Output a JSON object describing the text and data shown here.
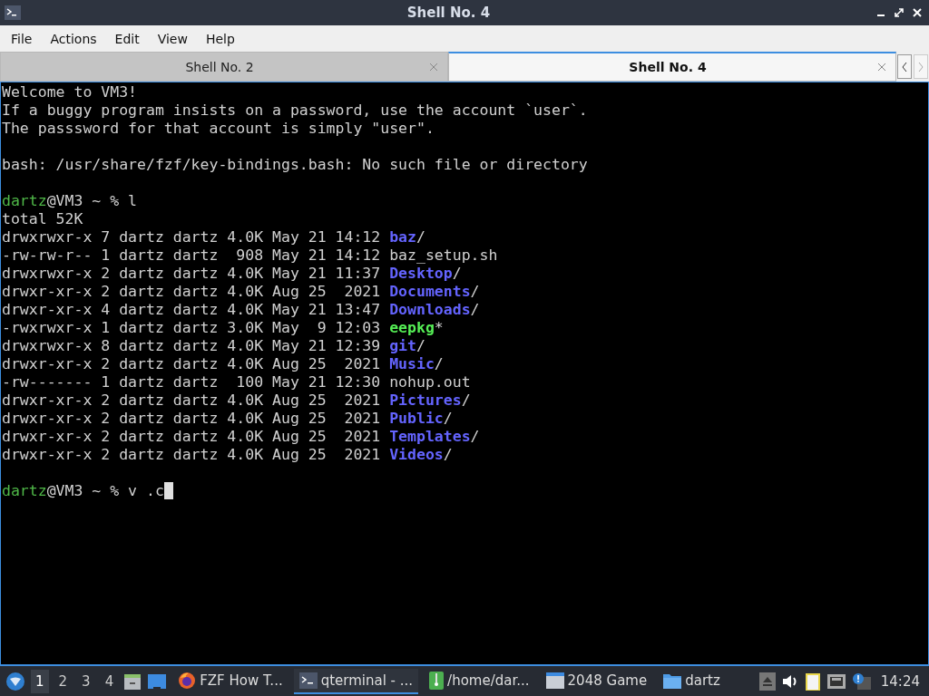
{
  "window": {
    "title": "Shell No. 4"
  },
  "menu": [
    "File",
    "Actions",
    "Edit",
    "View",
    "Help"
  ],
  "tabs": [
    {
      "label": "Shell No. 2",
      "selected": false
    },
    {
      "label": "Shell No. 4",
      "selected": true
    }
  ],
  "terminal": {
    "blocks": [
      {
        "lines": [
          [
            {
              "text": "Welcome to VM3!",
              "kind": "plain"
            }
          ],
          [
            {
              "text": "If a buggy program insists on a password, use the account `user`.",
              "kind": "plain"
            }
          ],
          [
            {
              "text": "The passsword for that account is simply \"user\".",
              "kind": "plain"
            }
          ]
        ]
      },
      {
        "lines": [
          [
            {
              "text": "bash: /usr/share/fzf/key-bindings.bash: No such file or directory",
              "kind": "plain"
            }
          ]
        ]
      },
      {
        "lines": [
          [
            {
              "text": "dartz",
              "kind": "user"
            },
            {
              "text": "@VM3 ~ % l",
              "kind": "plain"
            }
          ],
          [
            {
              "text": "total 52K",
              "kind": "plain"
            }
          ],
          [
            {
              "text": "drwxrwxr-x 7 dartz dartz 4.0K May 21 14:12 ",
              "kind": "plain"
            },
            {
              "text": "baz",
              "kind": "directory"
            },
            {
              "text": "/",
              "kind": "plain"
            }
          ],
          [
            {
              "text": "-rw-rw-r-- 1 dartz dartz  908 May 21 14:12 baz_setup.sh",
              "kind": "plain"
            }
          ],
          [
            {
              "text": "drwxrwxr-x 2 dartz dartz 4.0K May 21 11:37 ",
              "kind": "plain"
            },
            {
              "text": "Desktop",
              "kind": "directory"
            },
            {
              "text": "/",
              "kind": "plain"
            }
          ],
          [
            {
              "text": "drwxr-xr-x 2 dartz dartz 4.0K Aug 25  2021 ",
              "kind": "plain"
            },
            {
              "text": "Documents",
              "kind": "directory"
            },
            {
              "text": "/",
              "kind": "plain"
            }
          ],
          [
            {
              "text": "drwxr-xr-x 4 dartz dartz 4.0K May 21 13:47 ",
              "kind": "plain"
            },
            {
              "text": "Downloads",
              "kind": "directory"
            },
            {
              "text": "/",
              "kind": "plain"
            }
          ],
          [
            {
              "text": "-rwxrwxr-x 1 dartz dartz 3.0K May  9 12:03 ",
              "kind": "plain"
            },
            {
              "text": "eepkg",
              "kind": "executable"
            },
            {
              "text": "*",
              "kind": "plain"
            }
          ],
          [
            {
              "text": "drwxrwxr-x 8 dartz dartz 4.0K May 21 12:39 ",
              "kind": "plain"
            },
            {
              "text": "git",
              "kind": "directory"
            },
            {
              "text": "/",
              "kind": "plain"
            }
          ],
          [
            {
              "text": "drwxr-xr-x 2 dartz dartz 4.0K Aug 25  2021 ",
              "kind": "plain"
            },
            {
              "text": "Music",
              "kind": "directory"
            },
            {
              "text": "/",
              "kind": "plain"
            }
          ],
          [
            {
              "text": "-rw------- 1 dartz dartz  100 May 21 12:30 nohup.out",
              "kind": "plain"
            }
          ],
          [
            {
              "text": "drwxr-xr-x 2 dartz dartz 4.0K Aug 25  2021 ",
              "kind": "plain"
            },
            {
              "text": "Pictures",
              "kind": "directory"
            },
            {
              "text": "/",
              "kind": "plain"
            }
          ],
          [
            {
              "text": "drwxr-xr-x 2 dartz dartz 4.0K Aug 25  2021 ",
              "kind": "plain"
            },
            {
              "text": "Public",
              "kind": "directory"
            },
            {
              "text": "/",
              "kind": "plain"
            }
          ],
          [
            {
              "text": "drwxr-xr-x 2 dartz dartz 4.0K Aug 25  2021 ",
              "kind": "plain"
            },
            {
              "text": "Templates",
              "kind": "directory"
            },
            {
              "text": "/",
              "kind": "plain"
            }
          ],
          [
            {
              "text": "drwxr-xr-x 2 dartz dartz 4.0K Aug 25  2021 ",
              "kind": "plain"
            },
            {
              "text": "Videos",
              "kind": "directory"
            },
            {
              "text": "/",
              "kind": "plain"
            }
          ]
        ]
      },
      {
        "lines": [
          [
            {
              "text": "dartz",
              "kind": "user"
            },
            {
              "text": "@VM3 ~ % v .c",
              "kind": "plain"
            }
          ]
        ]
      }
    ],
    "cursor": true
  },
  "taskbar": {
    "desktops": [
      {
        "label": "1",
        "selected": true
      },
      {
        "label": "2",
        "selected": false
      },
      {
        "label": "3",
        "selected": false
      },
      {
        "label": "4",
        "selected": false
      }
    ],
    "tasks": [
      {
        "label": "FZF How T...",
        "kind": "browser",
        "selected": false
      },
      {
        "label": "qterminal - ...",
        "kind": "terminal",
        "selected": true
      },
      {
        "label": "/home/dar...",
        "kind": "archive",
        "selected": false
      },
      {
        "label": "2048 Game",
        "kind": "window",
        "selected": false
      },
      {
        "label": "dartz",
        "kind": "folder",
        "selected": false
      }
    ],
    "clock": "14:24"
  }
}
